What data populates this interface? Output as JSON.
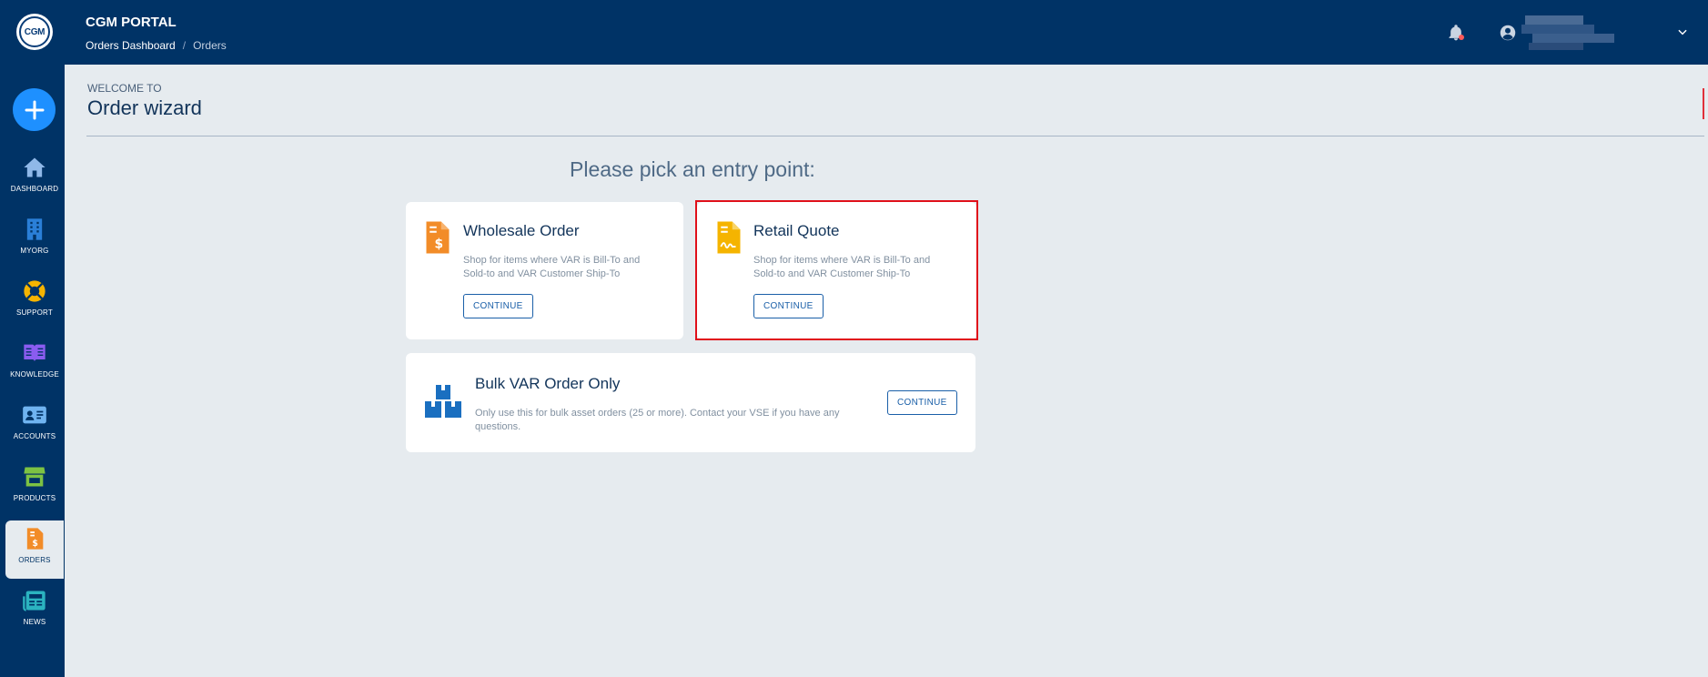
{
  "header": {
    "logo_text": "CGM",
    "title": "CGM PORTAL",
    "breadcrumb": {
      "parent": "Orders Dashboard",
      "separator": "/",
      "current": "Orders"
    }
  },
  "sidebar": {
    "items": [
      {
        "id": "dashboard",
        "label": "DASHBOARD",
        "icon": "home-icon",
        "color": "#8fb8e8"
      },
      {
        "id": "myorg",
        "label": "MYORG",
        "icon": "building-icon",
        "color": "#2a7fd8"
      },
      {
        "id": "support",
        "label": "SUPPORT",
        "icon": "lifebuoy-icon",
        "color": "#f5b400"
      },
      {
        "id": "knowledge",
        "label": "KNOWLEDGE",
        "icon": "book-icon",
        "color": "#8a5cf0"
      },
      {
        "id": "accounts",
        "label": "ACCOUNTS",
        "icon": "contact-card-icon",
        "color": "#6fb3f0"
      },
      {
        "id": "products",
        "label": "PRODUCTS",
        "icon": "store-icon",
        "color": "#7cc243"
      },
      {
        "id": "orders",
        "label": "ORDERS",
        "icon": "invoice-icon",
        "color": "#f28c28",
        "active": true
      },
      {
        "id": "news",
        "label": "NEWS",
        "icon": "newspaper-icon",
        "color": "#2bb3c0"
      }
    ]
  },
  "main": {
    "welcome": "WELCOME TO",
    "title": "Order wizard",
    "prompt": "Please pick an entry point:",
    "cards": [
      {
        "id": "wholesale",
        "title": "Wholesale Order",
        "desc_line1": "Shop for items where VAR is Bill-To and",
        "desc_line2": "Sold-to and VAR Customer Ship-To",
        "button": "CONTINUE",
        "icon": "invoice-dollar-icon",
        "icon_color": "#f28c28"
      },
      {
        "id": "retail",
        "title": "Retail Quote",
        "desc_line1": "Shop for items where VAR is Bill-To and",
        "desc_line2": "Sold-to and VAR Customer Ship-To",
        "button": "CONTINUE",
        "icon": "quote-signature-icon",
        "icon_color": "#f5b400",
        "selected": true
      },
      {
        "id": "bulk",
        "title": "Bulk VAR Order Only",
        "desc_line1": "Only use this for bulk asset orders (25 or more). Contact your VSE if you have any",
        "desc_line2": "questions.",
        "button": "CONTINUE",
        "icon": "boxes-icon",
        "icon_color": "#1a6fc0"
      }
    ]
  },
  "colors": {
    "navy": "#003366",
    "background": "#e6ebef",
    "accent_blue": "#1e90ff",
    "selected_outline": "#e0101a"
  }
}
